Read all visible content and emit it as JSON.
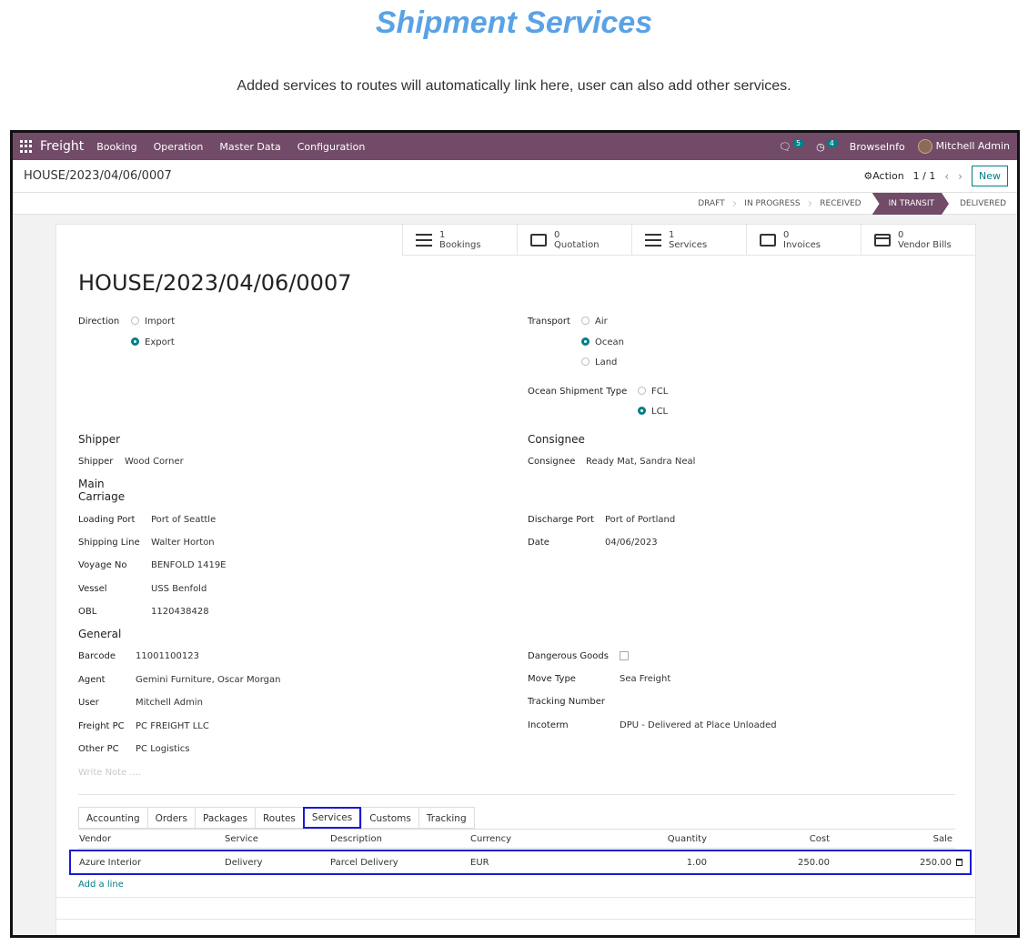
{
  "page": {
    "heading": "Shipment Services",
    "subheading": "Added services to routes will automatically link here, user can also add other services."
  },
  "navbar": {
    "app_name": "Freight",
    "menu": [
      "Booking",
      "Operation",
      "Master Data",
      "Configuration"
    ],
    "messages_count": "5",
    "activities_count": "4",
    "company": "BrowseInfo",
    "user": "Mitchell Admin"
  },
  "control": {
    "breadcrumb": "HOUSE/2023/04/06/0007",
    "action_label": "Action",
    "pager": "1 / 1",
    "new_label": "New"
  },
  "stages": [
    "DRAFT",
    "IN PROGRESS",
    "RECEIVED",
    "IN TRANSIT",
    "DELIVERED"
  ],
  "active_stage": "IN TRANSIT",
  "smart_buttons": [
    {
      "count": "1",
      "label": "Bookings",
      "icon": "list-icon"
    },
    {
      "count": "0",
      "label": "Quotation",
      "icon": "edit-icon"
    },
    {
      "count": "1",
      "label": "Services",
      "icon": "list-icon"
    },
    {
      "count": "0",
      "label": "Invoices",
      "icon": "edit-icon"
    },
    {
      "count": "0",
      "label": "Vendor Bills",
      "icon": "card-icon"
    }
  ],
  "record": {
    "title": "HOUSE/2023/04/06/0007",
    "direction": {
      "label": "Direction",
      "options": [
        "Import",
        "Export"
      ],
      "selected": "Export"
    },
    "transport": {
      "label": "Transport",
      "options": [
        "Air",
        "Ocean",
        "Land"
      ],
      "selected": "Ocean"
    },
    "ocean_type": {
      "label": "Ocean Shipment Type",
      "options": [
        "FCL",
        "LCL"
      ],
      "selected": "LCL"
    },
    "shipper_section": "Shipper",
    "shipper": {
      "label": "Shipper",
      "value": "Wood Corner"
    },
    "consignee_section": "Consignee",
    "consignee": {
      "label": "Consignee",
      "value": "Ready Mat, Sandra Neal"
    },
    "main_carriage_section_1": "Main",
    "main_carriage_section_2": "Carriage",
    "loading_port": {
      "label": "Loading Port",
      "value": "Port of Seattle"
    },
    "shipping_line": {
      "label": "Shipping Line",
      "value": "Walter Horton"
    },
    "voyage_no": {
      "label": "Voyage No",
      "value": "BENFOLD 1419E"
    },
    "vessel": {
      "label": "Vessel",
      "value": "USS Benfold"
    },
    "obl": {
      "label": "OBL",
      "value": "1120438428"
    },
    "discharge_port": {
      "label": "Discharge Port",
      "value": "Port of Portland"
    },
    "date": {
      "label": "Date",
      "value": "04/06/2023"
    },
    "general_section": "General",
    "barcode": {
      "label": "Barcode",
      "value": "11001100123"
    },
    "agent": {
      "label": "Agent",
      "value": "Gemini Furniture, Oscar Morgan"
    },
    "user": {
      "label": "User",
      "value": "Mitchell Admin"
    },
    "freight_pc": {
      "label": "Freight PC",
      "value": "PC FREIGHT LLC"
    },
    "other_pc": {
      "label": "Other PC",
      "value": "PC Logistics"
    },
    "dangerous_goods": {
      "label": "Dangerous Goods"
    },
    "move_type": {
      "label": "Move Type",
      "value": "Sea Freight"
    },
    "tracking_number": {
      "label": "Tracking Number",
      "value": ""
    },
    "incoterm": {
      "label": "Incoterm",
      "value": "DPU - Delivered at Place Unloaded"
    },
    "note_placeholder": "Write Note ...."
  },
  "tabs": [
    "Accounting",
    "Orders",
    "Packages",
    "Routes",
    "Services",
    "Customs",
    "Tracking"
  ],
  "active_tab": "Services",
  "services_table": {
    "columns": [
      "Vendor",
      "Service",
      "Description",
      "Currency",
      "Quantity",
      "Cost",
      "Sale"
    ],
    "rows": [
      {
        "vendor": "Azure Interior",
        "service": "Delivery",
        "description": "Parcel Delivery",
        "currency": "EUR",
        "quantity": "1.00",
        "cost": "250.00",
        "sale": "250.00"
      }
    ],
    "add_line": "Add a line"
  },
  "colors": {
    "brand": "#714b67",
    "accent": "#017e84",
    "highlight": "#1a1ad6",
    "heading": "#5aa2e6"
  }
}
